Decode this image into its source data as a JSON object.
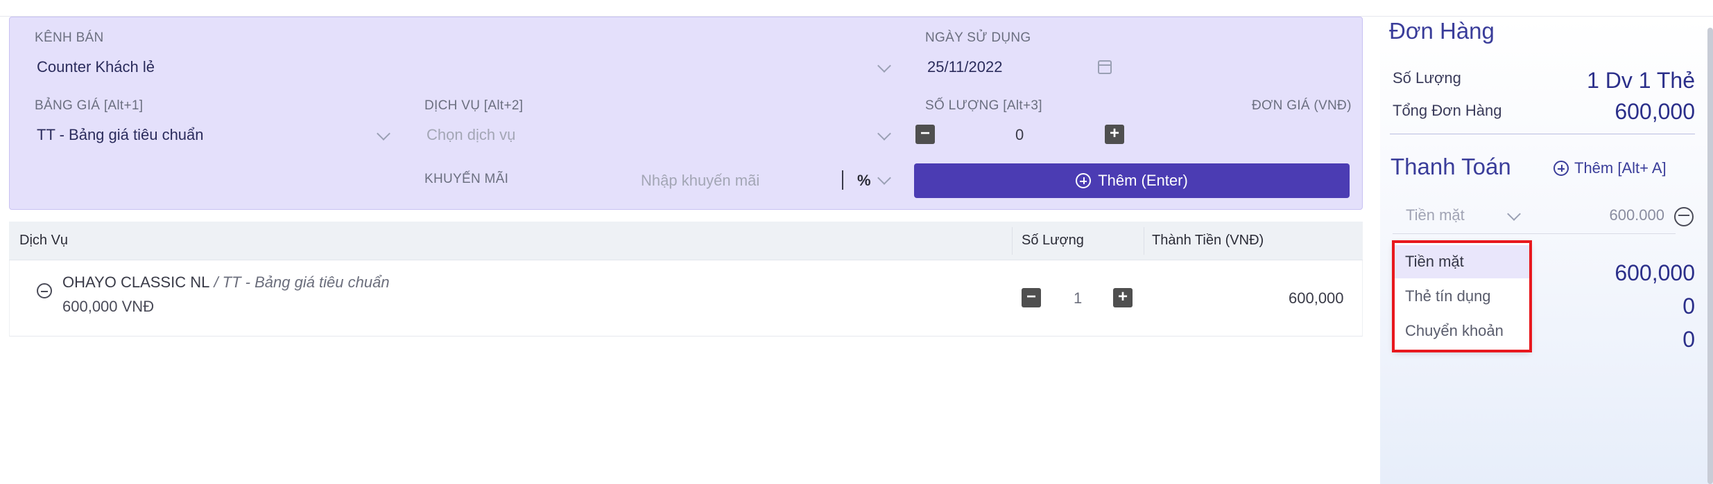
{
  "form": {
    "channel_label": "KÊNH BÁN",
    "channel_value": "Counter Khách lẻ",
    "date_label": "NGÀY SỬ DỤNG",
    "date_value": "25/11/2022",
    "pricelist_label": "BẢNG GIÁ [Alt+1]",
    "pricelist_value": "TT - Bảng giá tiêu chuẩn",
    "service_label": "DỊCH VỤ [Alt+2]",
    "service_placeholder": "Chọn dịch vụ",
    "quantity_label": "SỐ LƯỢNG [Alt+3]",
    "quantity_value": "0",
    "unit_price_label": "ĐƠN GIÁ (VNĐ)",
    "promo_label": "KHUYẾN MÃI",
    "promo_placeholder": "Nhập khuyến mãi",
    "promo_unit": "%",
    "add_button": "Thêm (Enter)"
  },
  "table": {
    "columns": [
      "Dịch Vụ",
      "Số Lượng",
      "Thành Tiền (VNĐ)"
    ],
    "rows": [
      {
        "service": "OHAYO CLASSIC NL",
        "pricelist": " / TT - Bảng giá tiêu chuẩn",
        "unit_price": "600,000 VNĐ",
        "quantity": "1",
        "total": "600,000"
      }
    ]
  },
  "order": {
    "title": "Đơn Hàng",
    "qty_label": "Số Lượng",
    "qty_value": "1 Dv 1 Thẻ",
    "total_label": "Tổng Đơn Hàng",
    "total_value": "600,000"
  },
  "payment": {
    "title": "Thanh Toán",
    "add_label": "Thêm [Alt+ A]",
    "method_selected": "Tiền mặt",
    "amount": "600.000",
    "summary_values": [
      "600,000",
      "0",
      "0"
    ],
    "options": [
      "Tiền mặt",
      "Thẻ tín dụng",
      "Chuyển khoản"
    ]
  },
  "colors": {
    "accent": "#4b3cb3",
    "panel_bg": "#e4e0fb",
    "highlight": "#e8181e"
  }
}
